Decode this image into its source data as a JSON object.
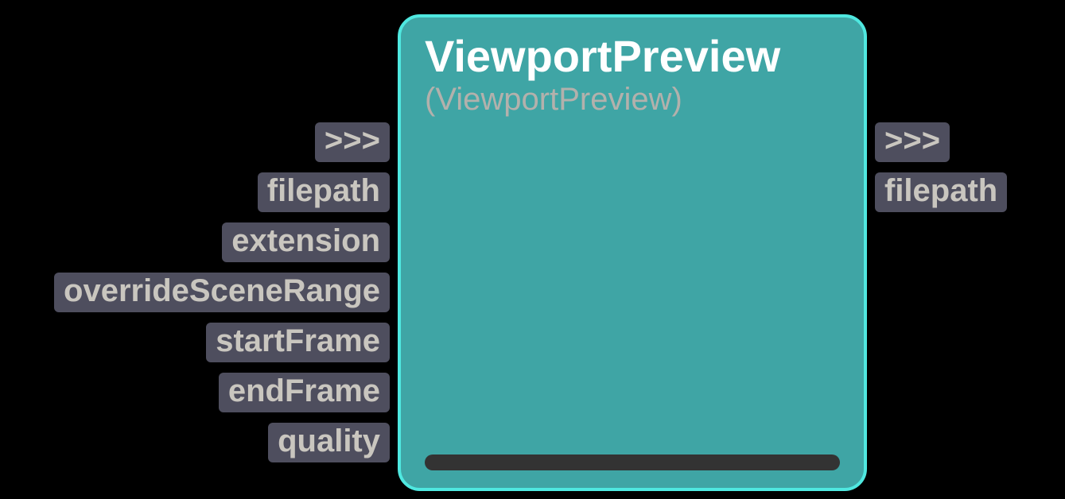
{
  "node": {
    "title": "ViewportPreview",
    "subtitle": "(ViewportPreview)"
  },
  "inputs": [
    {
      "label": ">>>"
    },
    {
      "label": "filepath"
    },
    {
      "label": "extension"
    },
    {
      "label": "overrideSceneRange"
    },
    {
      "label": "startFrame"
    },
    {
      "label": "endFrame"
    },
    {
      "label": "quality"
    }
  ],
  "outputs": [
    {
      "label": ">>>"
    },
    {
      "label": "filepath"
    }
  ]
}
